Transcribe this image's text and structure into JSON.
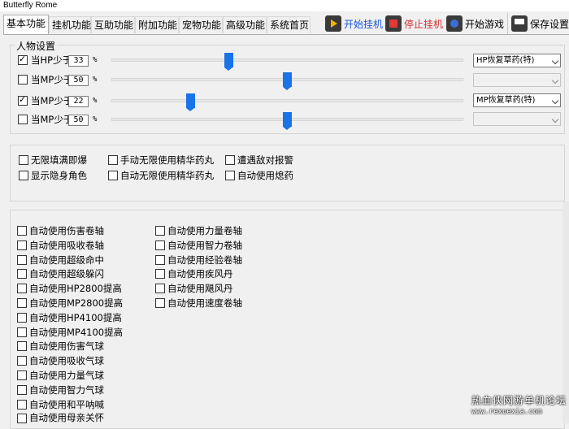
{
  "window": {
    "title": "Butterfly Rome"
  },
  "tabs": [
    "基本功能",
    "挂机功能",
    "互助功能",
    "附加功能",
    "宠物功能",
    "高级功能",
    "系统首页"
  ],
  "toolbar": {
    "start_hook": "开始挂机",
    "stop_hook": "停止挂机",
    "start_game": "开始游戏",
    "save_settings": "保存设置"
  },
  "character_settings": {
    "title": "人物设置",
    "rows": [
      {
        "checked": true,
        "label": "当HP少于",
        "value": "33",
        "unit": "%",
        "level": 33,
        "item": "HP恢复草药(特)",
        "enabled": true
      },
      {
        "checked": false,
        "label": "当MP少于",
        "value": "50",
        "unit": "%",
        "level": 50,
        "item": "",
        "enabled": false
      },
      {
        "checked": true,
        "label": "当MP少于",
        "value": "22",
        "unit": "%",
        "level": 22,
        "item": "MP恢复草药(特)",
        "enabled": true
      },
      {
        "checked": false,
        "label": "当MP少于",
        "value": "50",
        "unit": "%",
        "level": 50,
        "item": "",
        "enabled": false
      }
    ]
  },
  "options": [
    {
      "label": "无限填满即爆",
      "checked": false
    },
    {
      "label": "手动无限使用精华药丸",
      "checked": false
    },
    {
      "label": "遭遇敌对报警",
      "checked": false
    },
    {
      "label": "显示隐身角色",
      "checked": false
    },
    {
      "label": "自动无限使用精华药丸",
      "checked": false
    },
    {
      "label": "自动使用熄药",
      "checked": false
    }
  ],
  "auto_items": {
    "left": [
      "自动使用伤害卷轴",
      "自动使用吸收卷轴",
      "自动使用超级命中",
      "自动使用超级躲闪",
      "自动使用HP2800提高",
      "自动使用MP2800提高",
      "自动使用HP4100提高",
      "自动使用MP4100提高",
      "自动使用伤害气球",
      "自动使用吸收气球",
      "自动使用力量气球",
      "自动使用智力气球",
      "自动使用和平呐喊",
      "自动使用母亲关怀"
    ],
    "right": [
      "自动使用力量卷轴",
      "自动使用智力卷轴",
      "自动使用经验卷轴",
      "自动使用疾风丹",
      "自动使用飓风丹",
      "自动使用速度卷轴"
    ]
  },
  "watermark": {
    "line1": "热血侠网游单机论坛",
    "line2": "www.rexuexia.com"
  },
  "colors": {
    "accent_blue": "#1a73e8",
    "stop_red": "#e53935"
  }
}
